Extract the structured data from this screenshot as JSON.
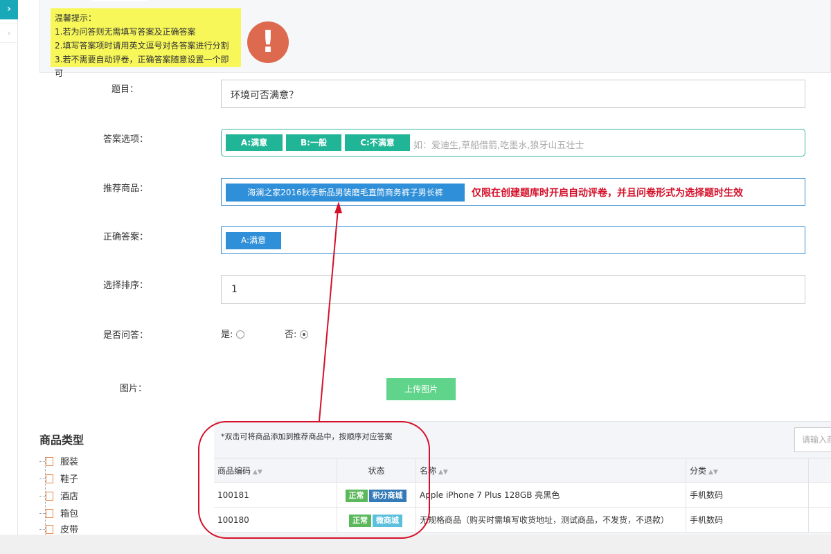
{
  "sidebar": {
    "toggle_icon": "›",
    "second_icon": "›"
  },
  "tip": {
    "lines": [
      "温馨提示：",
      "1.若为问答则无需填写答案及正确答案",
      "2.填写答案项时请用英文逗号对各答案进行分割",
      "3.若不需要自动评卷，正确答案随意设置一个即可"
    ],
    "warn_icon": "!"
  },
  "form": {
    "question_label": "题目：",
    "question_value": "环境可否满意？",
    "options_label": "答案选项：",
    "options": [
      "A:满意",
      "B:一般",
      "C:不满意"
    ],
    "options_placeholder": "如：爱迪生,草船借箭,吃墨水,狼牙山五壮士",
    "recommend_label": "推荐商品：",
    "recommend_item": "海澜之家2016秋季新品男装磨毛直筒商务裤子男长裤",
    "recommend_note": "仅限在创建题库时开启自动评卷，并且问卷形式为选择题时生效",
    "correct_label": "正确答案：",
    "correct_value": "A:满意",
    "order_label": "选择排序：",
    "order_value": "1",
    "qa_label": "是否问答：",
    "qa_yes": "是:",
    "qa_no": "否:",
    "image_label": "图片：",
    "upload_label": "上传图片"
  },
  "categories": {
    "title": "商品类型",
    "items": [
      "服装",
      "鞋子",
      "酒店",
      "箱包",
      "皮带"
    ]
  },
  "products": {
    "hint": "*双击可将商品添加到推荐商品中，按顺序对应答案",
    "search_placeholder": "请输入商",
    "columns": [
      "商品编码",
      "状态",
      "名称",
      "分类"
    ],
    "rows": [
      {
        "code": "100181",
        "status": "正常",
        "channel": "积分商城",
        "name": "Apple iPhone 7 Plus 128GB 亮黑色",
        "category": "手机数码"
      },
      {
        "code": "100180",
        "status": "正常",
        "channel": "微商城",
        "name": "无规格商品（购买时需填写收货地址，测试商品，不发货，不退款）",
        "category": "手机数码"
      }
    ]
  },
  "colors": {
    "accent_teal": "#19a8b8",
    "tag_green": "#1fb596",
    "tag_blue": "#2f8fd8",
    "warn": "#dd6a4e",
    "note_red": "#d4102a",
    "upload_green": "#5fd48a"
  }
}
